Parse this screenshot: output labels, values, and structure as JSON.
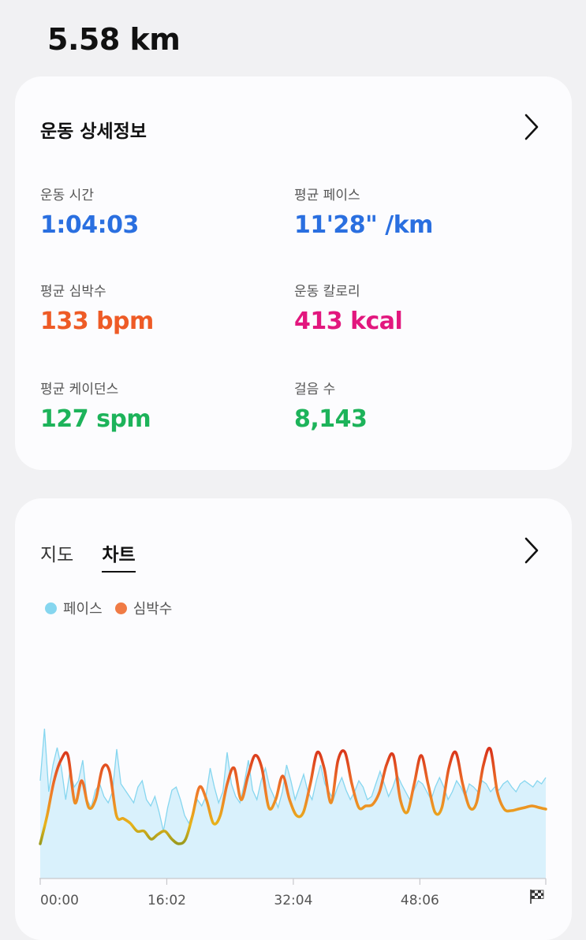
{
  "header": {
    "distance": "5.58 km"
  },
  "details": {
    "title": "운동 상세정보",
    "metrics": [
      {
        "label": "운동 시간",
        "value": "1:04:03",
        "color": "#2a6fe0"
      },
      {
        "label": "평균 페이스",
        "value": "11'28\" /km",
        "color": "#2a6fe0"
      },
      {
        "label": "평균 심박수",
        "value": "133 bpm",
        "color": "#ee5b26"
      },
      {
        "label": "운동 칼로리",
        "value": "413 kcal",
        "color": "#e2177e"
      },
      {
        "label": "평균 케이던스",
        "value": "127 spm",
        "color": "#1db35a"
      },
      {
        "label": "걸음 수",
        "value": "8,143",
        "color": "#1db35a"
      }
    ]
  },
  "chart_card": {
    "tabs": [
      {
        "label": "지도",
        "active": false
      },
      {
        "label": "차트",
        "active": true
      }
    ],
    "legend": [
      {
        "label": "페이스",
        "color": "#86d6ef"
      },
      {
        "label": "심박수",
        "color": "#f07b45"
      }
    ]
  },
  "icons": {
    "details_more": "chevron-right-icon",
    "chart_more": "chevron-right-icon",
    "finish": "checkered-flag-icon"
  },
  "chart_data": {
    "type": "area",
    "x_ticks": [
      "00:00",
      "16:02",
      "32:04",
      "48:06"
    ],
    "x_range_minutes": [
      0,
      64.05
    ],
    "grid": false,
    "legend_position": "top-left",
    "series": [
      {
        "name": "페이스",
        "color": "#86d6ef",
        "values": [
          0.62,
          0.95,
          0.55,
          0.72,
          0.83,
          0.7,
          0.5,
          0.68,
          0.58,
          0.62,
          0.75,
          0.5,
          0.45,
          0.56,
          0.6,
          0.52,
          0.48,
          0.55,
          0.82,
          0.6,
          0.56,
          0.52,
          0.48,
          0.58,
          0.62,
          0.5,
          0.46,
          0.52,
          0.42,
          0.3,
          0.45,
          0.56,
          0.58,
          0.5,
          0.4,
          0.35,
          0.42,
          0.5,
          0.46,
          0.52,
          0.7,
          0.58,
          0.48,
          0.55,
          0.8,
          0.6,
          0.52,
          0.48,
          0.6,
          0.75,
          0.56,
          0.5,
          0.62,
          0.7,
          0.58,
          0.52,
          0.45,
          0.55,
          0.72,
          0.62,
          0.5,
          0.58,
          0.66,
          0.55,
          0.5,
          0.62,
          0.72,
          0.6,
          0.55,
          0.5,
          0.58,
          0.64,
          0.56,
          0.5,
          0.55,
          0.62,
          0.58,
          0.5,
          0.52,
          0.6,
          0.68,
          0.6,
          0.52,
          0.58,
          0.66,
          0.6,
          0.55,
          0.5,
          0.56,
          0.62,
          0.6,
          0.55,
          0.5,
          0.58,
          0.64,
          0.58,
          0.5,
          0.55,
          0.62,
          0.58,
          0.52,
          0.6,
          0.58,
          0.55,
          0.62,
          0.6,
          0.55,
          0.58,
          0.56,
          0.6,
          0.62,
          0.58,
          0.55,
          0.6,
          0.62,
          0.6,
          0.58,
          0.62,
          0.6,
          0.64
        ]
      },
      {
        "name": "심박수",
        "color": "#f07b45",
        "values": [
          0.22,
          0.4,
          0.62,
          0.75,
          0.78,
          0.48,
          0.62,
          0.45,
          0.5,
          0.7,
          0.68,
          0.4,
          0.38,
          0.35,
          0.3,
          0.3,
          0.25,
          0.28,
          0.3,
          0.25,
          0.22,
          0.25,
          0.4,
          0.58,
          0.5,
          0.35,
          0.4,
          0.6,
          0.7,
          0.5,
          0.65,
          0.78,
          0.7,
          0.45,
          0.5,
          0.65,
          0.5,
          0.4,
          0.42,
          0.6,
          0.8,
          0.7,
          0.48,
          0.75,
          0.8,
          0.6,
          0.45,
          0.46,
          0.47,
          0.55,
          0.72,
          0.78,
          0.5,
          0.42,
          0.6,
          0.78,
          0.6,
          0.42,
          0.45,
          0.7,
          0.8,
          0.6,
          0.45,
          0.48,
          0.72,
          0.82,
          0.55,
          0.44,
          0.43,
          0.44,
          0.45,
          0.46,
          0.45,
          0.44
        ]
      }
    ]
  }
}
